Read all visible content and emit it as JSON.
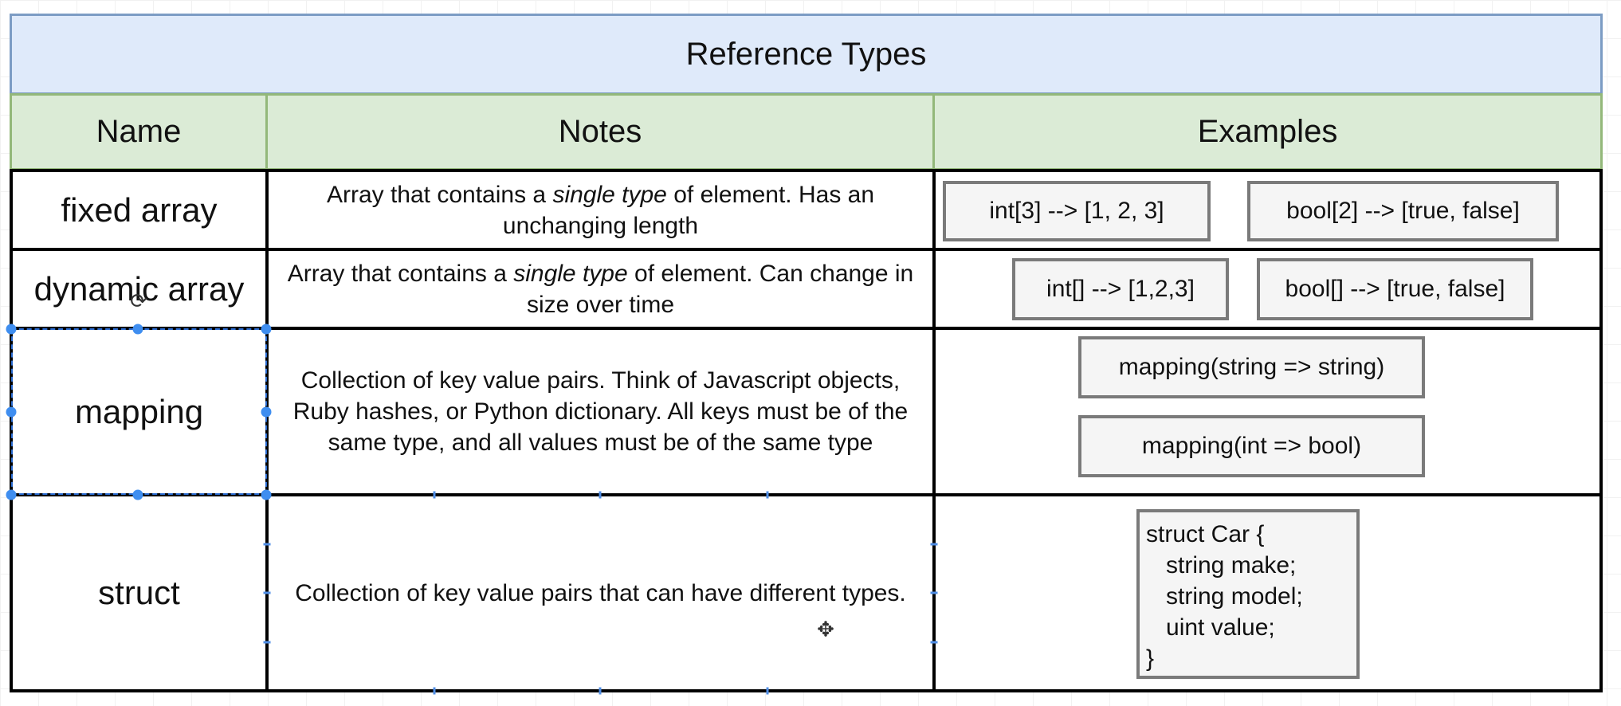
{
  "title": "Reference Types",
  "columns": [
    "Name",
    "Notes",
    "Examples"
  ],
  "rows": [
    {
      "name": "fixed array",
      "notes_parts": [
        "Array that contains a ",
        "single type",
        " of element.  Has an unchanging length"
      ],
      "examples": [
        "int[3] --> [1, 2, 3]",
        "bool[2] --> [true, false]"
      ]
    },
    {
      "name": "dynamic array",
      "notes_parts": [
        "Array that contains a ",
        "single type",
        " of element.  Can change in size over time"
      ],
      "examples": [
        "int[] --> [1,2,3]",
        "bool[] --> [true, false]"
      ]
    },
    {
      "name": "mapping",
      "notes": "Collection of key value pairs.  Think of Javascript objects, Ruby hashes, or Python dictionary. All keys must be of the same type, and all values must be of the same type",
      "examples": [
        "mapping(string => string)",
        "mapping(int => bool)"
      ]
    },
    {
      "name": "struct",
      "notes": "Collection of key value pairs that can have different types.",
      "examples": [
        "struct Car {\n   string make;\n   string model;\n   uint value;\n}"
      ]
    }
  ],
  "selection": {
    "selected_cell": "mapping"
  },
  "cursors": {
    "rotate_cursor": "⟳",
    "move_cursor": "✥"
  },
  "colors": {
    "title_fill": "#dfeafa",
    "title_border": "#7c9cc4",
    "header_fill": "#dbebd6",
    "header_border": "#93b87a",
    "example_fill": "#f5f5f5",
    "example_border": "#7a7a7a",
    "selection": "#3f8ef0"
  }
}
